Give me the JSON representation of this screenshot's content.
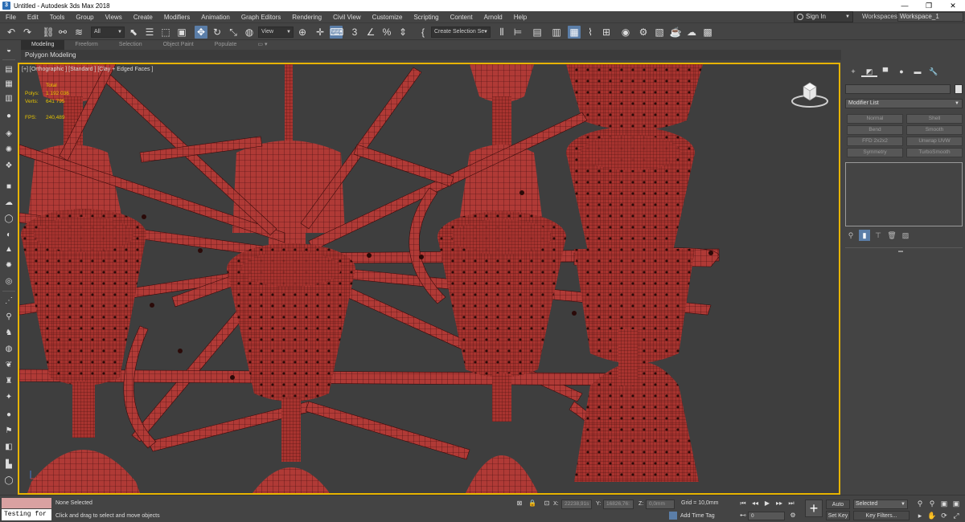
{
  "window": {
    "title": "Untitled - Autodesk 3ds Max 2018",
    "minimize": "—",
    "maximize": "❐",
    "close": "✕"
  },
  "menu": [
    "File",
    "Edit",
    "Tools",
    "Group",
    "Views",
    "Create",
    "Modifiers",
    "Animation",
    "Graph Editors",
    "Rendering",
    "Civil View",
    "Customize",
    "Scripting",
    "Content",
    "Arnold",
    "Help"
  ],
  "account": {
    "sign_in": "Sign In",
    "workspaces_label": "Workspaces:",
    "workspace": "Workspace_1"
  },
  "toolbar": {
    "filter": "All",
    "ref_coord": "View",
    "selection_set": "Create Selection Se"
  },
  "ribbon": {
    "tabs": [
      "Modeling",
      "Freeform",
      "Selection",
      "Object Paint",
      "Populate"
    ],
    "active_tab": 0,
    "panel_label": "Polygon Modeling"
  },
  "viewport": {
    "label": "[+] [Orthographic ] [Standard ] [Clay + Edged Faces ]",
    "stats": {
      "total_label": "Total",
      "polys_label": "Polys:",
      "polys": "1 192 036",
      "verts_label": "Verts:",
      "verts": "641 795",
      "fps_label": "FPS:",
      "fps": "240,489"
    }
  },
  "command_panel": {
    "modifier_list": "Modifier List",
    "modifiers": [
      "Normal",
      "Shell",
      "Bend",
      "Smooth",
      "FFD 2x2x2",
      "Unwrap UVW",
      "Symmetry",
      "TurboSmooth"
    ]
  },
  "status": {
    "maxscript": "Testing for :",
    "selection": "None Selected",
    "prompt": "Click and drag to select and move objects",
    "x_label": "X:",
    "x": "22238,91s",
    "y_label": "Y:",
    "y": "16826,76:",
    "z_label": "Z:",
    "z": "0,0mm",
    "grid": "Grid = 10,0mm",
    "add_time_tag": "Add Time Tag",
    "frame": "0",
    "auto_key": "Auto Key",
    "set_key": "Set Key",
    "selected": "Selected",
    "key_filters": "Key Filters..."
  },
  "colors": {
    "model": "#b03a36",
    "wire": "#3a0c0c",
    "viewport_border": "#e8b400",
    "active_blue": "#5b7ea8"
  }
}
